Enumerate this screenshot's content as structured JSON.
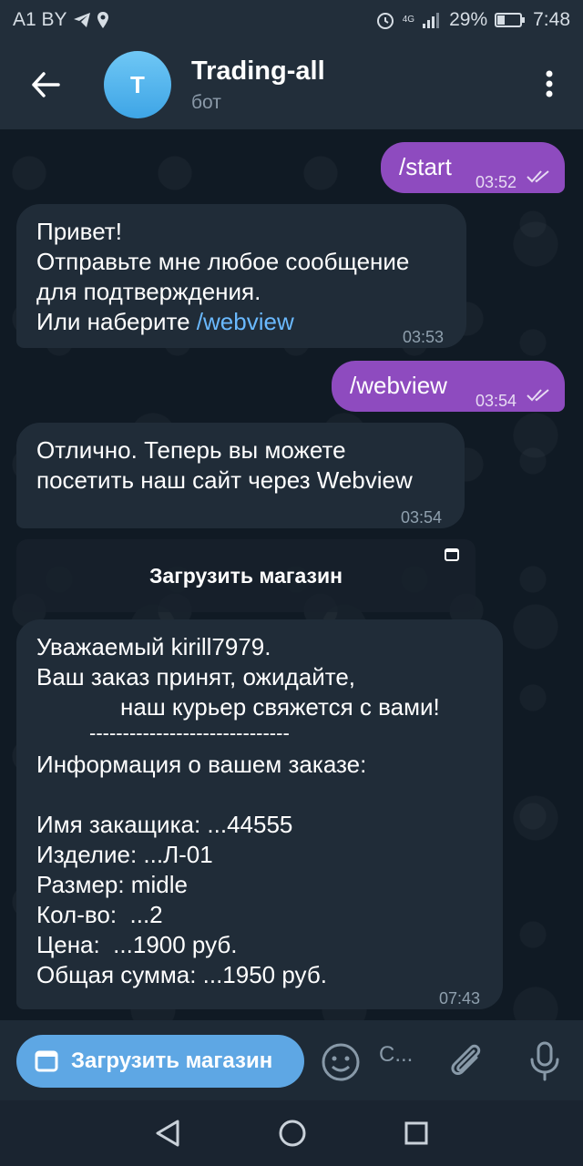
{
  "status_bar": {
    "carrier": "A1 BY",
    "network": "4G",
    "battery": "29%",
    "time": "7:48"
  },
  "header": {
    "avatar_letter": "T",
    "title": "Trading-all",
    "subtitle": "бот"
  },
  "messages": [
    {
      "dir": "out",
      "text": "/start",
      "time": "03:52"
    },
    {
      "dir": "in",
      "lines": [
        "Привет!",
        "Отправьте мне любое сообщение",
        "для подтверждения."
      ],
      "line4_prefix": "Или наберите ",
      "line4_link": "/webview",
      "time": "03:53"
    },
    {
      "dir": "out",
      "text": "/webview",
      "time": "03:54"
    },
    {
      "dir": "in",
      "lines": [
        "Отлично. Теперь вы можете",
        "посетить наш сайт через Webview"
      ],
      "time": "03:54"
    },
    {
      "dir": "in",
      "lines": [
        "Уважаемый kirill7979.",
        "Ваш заказ принят, ожидайте,",
        "наш курьер свяжется с вами!",
        "------------------------------",
        "Информация о вашем заказе:",
        "",
        "Имя закащика: ...44555",
        "Изделие: ...Л-01",
        "Размер: midle",
        "Кол-во:  ...2",
        "Цена:  ...1900 руб.",
        "Общая сумма: ...1950 руб."
      ],
      "time": "07:43"
    }
  ],
  "webview_button": {
    "label": "Загрузить магазин"
  },
  "input_bar": {
    "shop_button_label": "Загрузить магазин",
    "placeholder": "С..."
  },
  "colors": {
    "outgoing_bubble": "#8e4bbf",
    "incoming_bubble": "#202c38",
    "accent": "#5ea7e4",
    "link": "#6ab9ff"
  }
}
